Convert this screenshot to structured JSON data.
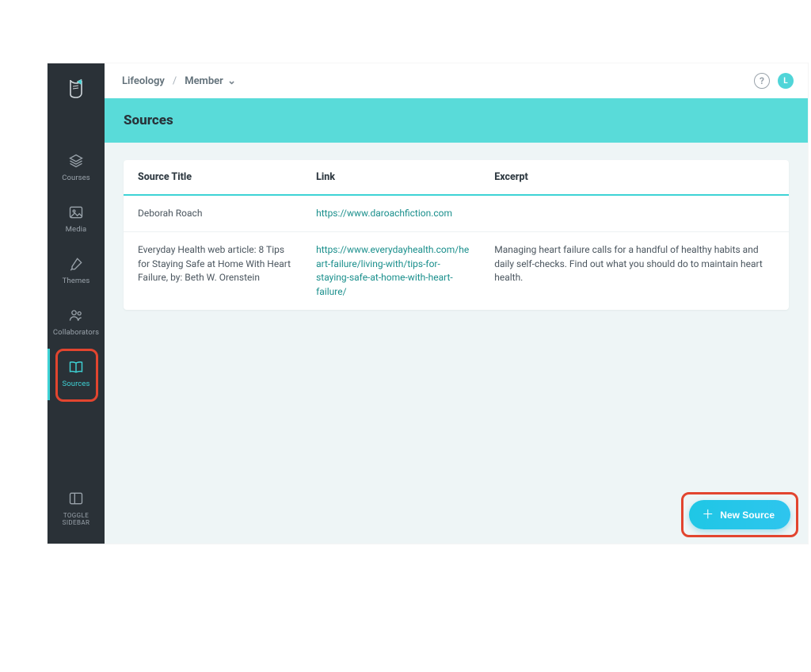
{
  "breadcrumb": {
    "root": "Lifeology",
    "current": "Member"
  },
  "avatar_initial": "L",
  "page": {
    "title": "Sources"
  },
  "sidebar": {
    "items": [
      {
        "label": "Courses"
      },
      {
        "label": "Media"
      },
      {
        "label": "Themes"
      },
      {
        "label": "Collaborators"
      },
      {
        "label": "Sources"
      }
    ],
    "toggle_line1": "TOGGLE",
    "toggle_line2": "SIDEBAR"
  },
  "table": {
    "headers": {
      "title": "Source Title",
      "link": "Link",
      "excerpt": "Excerpt"
    },
    "rows": [
      {
        "title": "Deborah Roach",
        "link": "https://www.daroachfiction.com",
        "excerpt": ""
      },
      {
        "title": "Everyday Health web article: 8 Tips for Staying Safe at Home With Heart Failure, by: Beth W. Orenstein",
        "link": "https://www.everydayhealth.com/heart-failure/living-with/tips-for-staying-safe-at-home-with-heart-failure/",
        "excerpt": "Managing heart failure calls for a handful of healthy habits and daily self-checks. Find out what you should do to maintain heart health."
      }
    ]
  },
  "fab": {
    "label": "New Source"
  }
}
